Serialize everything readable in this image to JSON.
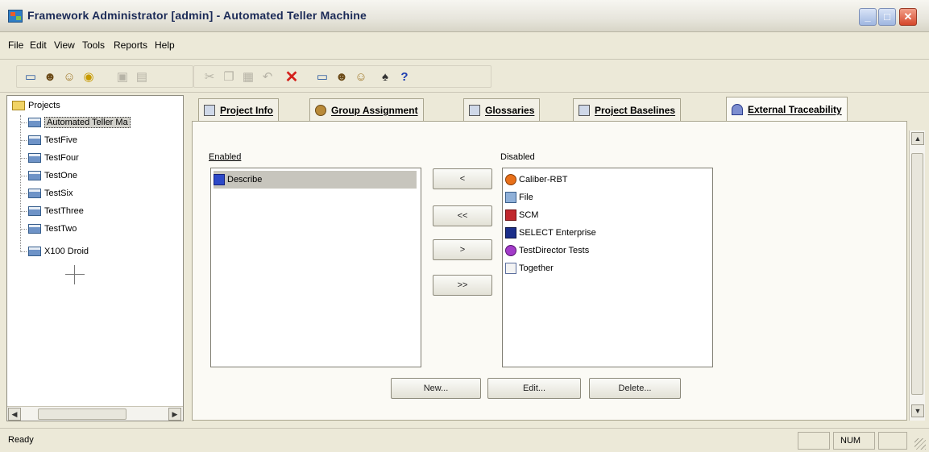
{
  "window": {
    "title": "Framework Administrator [admin] - Automated Teller Machine",
    "controls": [
      "minimize",
      "maximize",
      "close"
    ]
  },
  "menubar": {
    "items": [
      "File",
      "Edit",
      "View",
      "Tools",
      "Reports",
      "Help"
    ]
  },
  "toolbar": {
    "icons": [
      "project-icon",
      "group-icon",
      "user-icon",
      "target-icon",
      "save-icon",
      "save-all-icon",
      "cut-icon",
      "copy-icon",
      "paste-icon",
      "undo-icon",
      "delete-icon",
      "window-icon",
      "traceability-icon",
      "link-icon",
      "find-icon",
      "help-icon"
    ]
  },
  "tree": {
    "root": "Projects",
    "items": [
      "Automated Teller Ma",
      "TestFive",
      "TestFour",
      "TestOne",
      "TestSix",
      "TestThree",
      "TestTwo",
      "X100 Droid"
    ],
    "selected": "Automated Teller Ma"
  },
  "tabs": [
    {
      "label": "Project Info",
      "icon": "project-info-icon"
    },
    {
      "label": "Group Assignment",
      "icon": "group-assignment-icon"
    },
    {
      "label": "Glossaries",
      "icon": "glossaries-icon"
    },
    {
      "label": "Project Baselines",
      "icon": "baselines-icon"
    },
    {
      "label": "External Traceability",
      "icon": "traceability-icon"
    }
  ],
  "active_tab": "External Traceability",
  "traceability": {
    "enabled_label": "Enabled",
    "disabled_label": "Disabled",
    "enabled_items": [
      "Describe"
    ],
    "disabled_items": [
      "Caliber-RBT",
      "File",
      "SCM",
      "SELECT Enterprise",
      "TestDirector Tests",
      "Together"
    ],
    "move_buttons": [
      "<",
      "<<",
      ">",
      ">>"
    ],
    "action_buttons": [
      "New...",
      "Edit...",
      "Delete..."
    ]
  },
  "statusbar": {
    "text": "Ready",
    "num": "NUM"
  },
  "colors": {
    "window_bg": "#ece9d8",
    "title_text": "#1b2a57",
    "selection": "#c7c5bd"
  }
}
